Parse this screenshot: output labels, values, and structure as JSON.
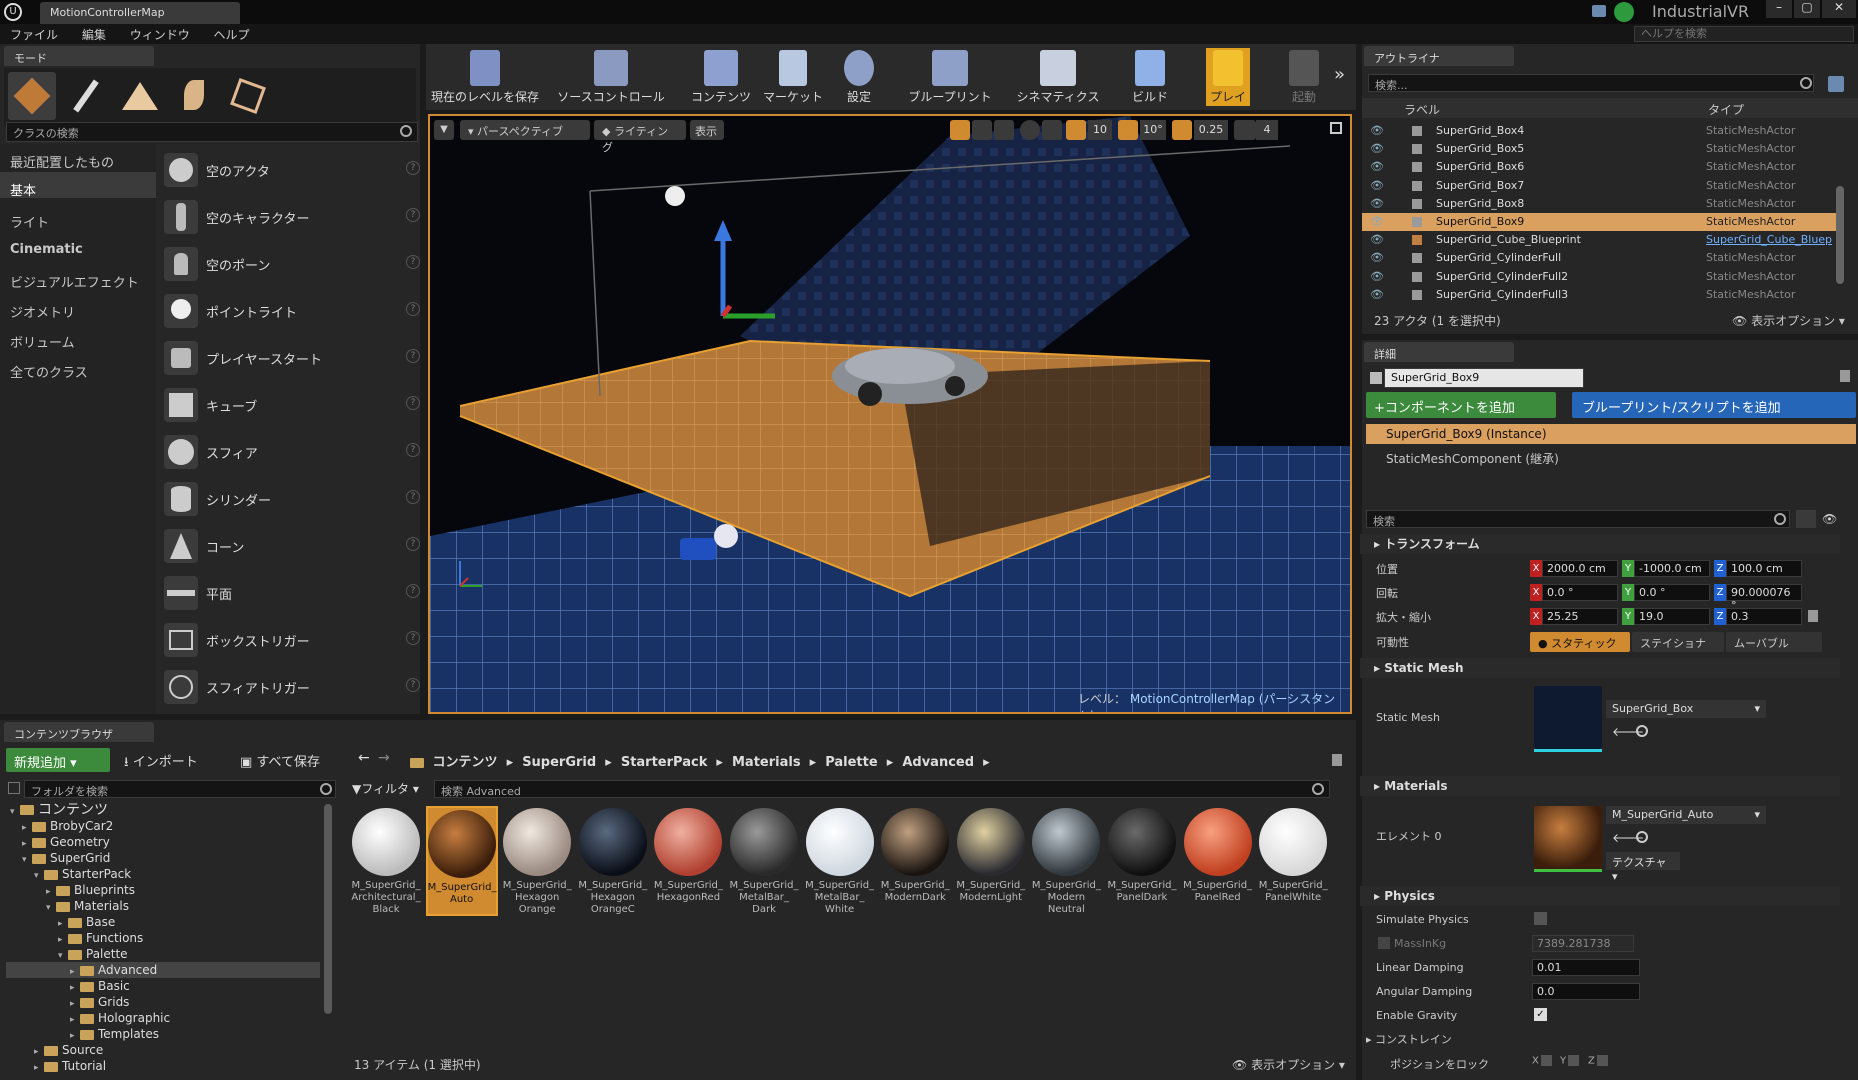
{
  "app": {
    "tab_title": "MotionControllerMap",
    "project": "IndustrialVR",
    "help_search": "ヘルプを検索"
  },
  "menu": [
    "ファイル",
    "編集",
    "ウィンドウ",
    "ヘルプ"
  ],
  "modes": {
    "tab": "モード",
    "search_placeholder": "クラスの検索",
    "categories": [
      "最近配置したもの",
      "基本",
      "ライト",
      "Cinematic",
      "ビジュアルエフェクト",
      "ジオメトリ",
      "ボリューム",
      "全てのクラス"
    ],
    "items": [
      "空のアクタ",
      "空のキャラクター",
      "空のポーン",
      "ポイントライト",
      "プレイヤースタート",
      "キューブ",
      "スフィア",
      "シリンダー",
      "コーン",
      "平面",
      "ボックストリガー",
      "スフィアトリガー"
    ]
  },
  "toolbar": [
    {
      "label": "現在のレベルを保存",
      "icon": "save-icon"
    },
    {
      "label": "ソースコントロール",
      "icon": "source-control-icon"
    },
    {
      "label": "コンテンツ",
      "icon": "content-icon"
    },
    {
      "label": "マーケット",
      "icon": "market-icon"
    },
    {
      "label": "設定",
      "icon": "settings-icon"
    },
    {
      "label": "ブループリント",
      "icon": "blueprint-icon"
    },
    {
      "label": "シネマティクス",
      "icon": "cinematics-icon"
    },
    {
      "label": "ビルド",
      "icon": "build-icon"
    },
    {
      "label": "プレイ",
      "icon": "play-icon"
    },
    {
      "label": "起動",
      "icon": "launch-icon"
    }
  ],
  "viewport": {
    "perspective": "パースペクティブ",
    "lighting": "ライティング",
    "show": "表示",
    "grid": "10",
    "rot": "10°",
    "scale": "0.25",
    "speed": "4",
    "level_prefix": "レベル：",
    "level_name": "MotionControllerMap (パーシスタント)"
  },
  "outliner": {
    "tab": "アウトライナ",
    "search_placeholder": "検索...",
    "col_label": "ラベル",
    "col_type": "タイプ",
    "rows": [
      {
        "label": "SuperGrid_Box4",
        "type": "StaticMeshActor"
      },
      {
        "label": "SuperGrid_Box5",
        "type": "StaticMeshActor"
      },
      {
        "label": "SuperGrid_Box6",
        "type": "StaticMeshActor"
      },
      {
        "label": "SuperGrid_Box7",
        "type": "StaticMeshActor"
      },
      {
        "label": "SuperGrid_Box8",
        "type": "StaticMeshActor"
      },
      {
        "label": "SuperGrid_Box9",
        "type": "StaticMeshActor"
      },
      {
        "label": "SuperGrid_Cube_Blueprint",
        "type": "SuperGrid_Cube_Bluep"
      },
      {
        "label": "SuperGrid_CylinderFull",
        "type": "StaticMeshActor"
      },
      {
        "label": "SuperGrid_CylinderFull2",
        "type": "StaticMeshActor"
      },
      {
        "label": "SuperGrid_CylinderFull3",
        "type": "StaticMeshActor"
      }
    ],
    "status": "23 アクタ (1 を選択中)",
    "view_options": "表示オプション"
  },
  "details": {
    "tab": "詳細",
    "name": "SuperGrid_Box9",
    "add_component": "+コンポーネントを追加",
    "add_blueprint": "ブループリント/スクリプトを追加",
    "instance": "SuperGrid_Box9 (Instance)",
    "component": "StaticMeshComponent (継承)",
    "search_placeholder": "検索",
    "transform": {
      "title": "トランスフォーム",
      "location_label": "位置",
      "rotation_label": "回転",
      "scale_label": "拡大・縮小",
      "mobility_label": "可動性",
      "location": [
        "2000.0 cm",
        "-1000.0 cm",
        "100.0 cm"
      ],
      "rotation": [
        "0.0 °",
        "0.0 °",
        "90.000076 °"
      ],
      "scale": [
        "25.25",
        "19.0",
        "0.3"
      ],
      "mobility": [
        "スタティック",
        "ステイショナ",
        "ムーバブル"
      ]
    },
    "static_mesh": {
      "title": "Static Mesh",
      "label": "Static Mesh",
      "value": "SuperGrid_Box"
    },
    "materials": {
      "title": "Materials",
      "label": "エレメント 0",
      "value": "M_SuperGrid_Auto",
      "texture": "テクスチャ"
    },
    "physics": {
      "title": "Physics",
      "simulate": "Simulate Physics",
      "mass_label": "MassInKg",
      "mass": "7389.281738",
      "linear_label": "Linear Damping",
      "linear": "0.01",
      "angular_label": "Angular Damping",
      "angular": "0.0",
      "gravity": "Enable Gravity",
      "constraint": "コンストレイン",
      "lock_label": "ポジションをロック"
    }
  },
  "content": {
    "tab": "コンテンツブラウザ",
    "add_new": "新規追加",
    "import": "インポート",
    "save_all": "すべて保存",
    "breadcrumb": [
      "コンテンツ",
      "SuperGrid",
      "StarterPack",
      "Materials",
      "Palette",
      "Advanced"
    ],
    "folder_search": "フォルダを検索",
    "filter": "フィルタ",
    "search_placeholder": "検索 Advanced",
    "tree": [
      {
        "label": "コンテンツ",
        "level": 0
      },
      {
        "label": "BrobyCar2",
        "level": 1
      },
      {
        "label": "Geometry",
        "level": 1
      },
      {
        "label": "SuperGrid",
        "level": 1
      },
      {
        "label": "StarterPack",
        "level": 2
      },
      {
        "label": "Blueprints",
        "level": 3
      },
      {
        "label": "Materials",
        "level": 3
      },
      {
        "label": "Base",
        "level": 4
      },
      {
        "label": "Functions",
        "level": 4
      },
      {
        "label": "Palette",
        "level": 4
      },
      {
        "label": "Advanced",
        "level": 5
      },
      {
        "label": "Basic",
        "level": 5
      },
      {
        "label": "Grids",
        "level": 5
      },
      {
        "label": "Holographic",
        "level": 5
      },
      {
        "label": "Templates",
        "level": 5
      },
      {
        "label": "Source",
        "level": 2
      },
      {
        "label": "Tutorial",
        "level": 2
      }
    ],
    "assets": [
      "M_SuperGrid_ Architectural_ Black",
      "M_SuperGrid_ Auto",
      "M_SuperGrid_ Hexagon Orange",
      "M_SuperGrid_ Hexagon OrangeC",
      "M_SuperGrid_ HexagonRed",
      "M_SuperGrid_ MetalBar_ Dark",
      "M_SuperGrid_ MetalBar_ White",
      "M_SuperGrid_ ModernDark",
      "M_SuperGrid_ ModernLight",
      "M_SuperGrid_ Modern Neutral",
      "M_SuperGrid_ PanelDark",
      "M_SuperGrid_ PanelRed",
      "M_SuperGrid_ PanelWhite"
    ],
    "status": "13 アイテム (1 選択中)",
    "view_options": "表示オプション"
  },
  "colors": {
    "accent": "#d08a30",
    "green": "#3c8a3c",
    "blue": "#2666b8"
  }
}
